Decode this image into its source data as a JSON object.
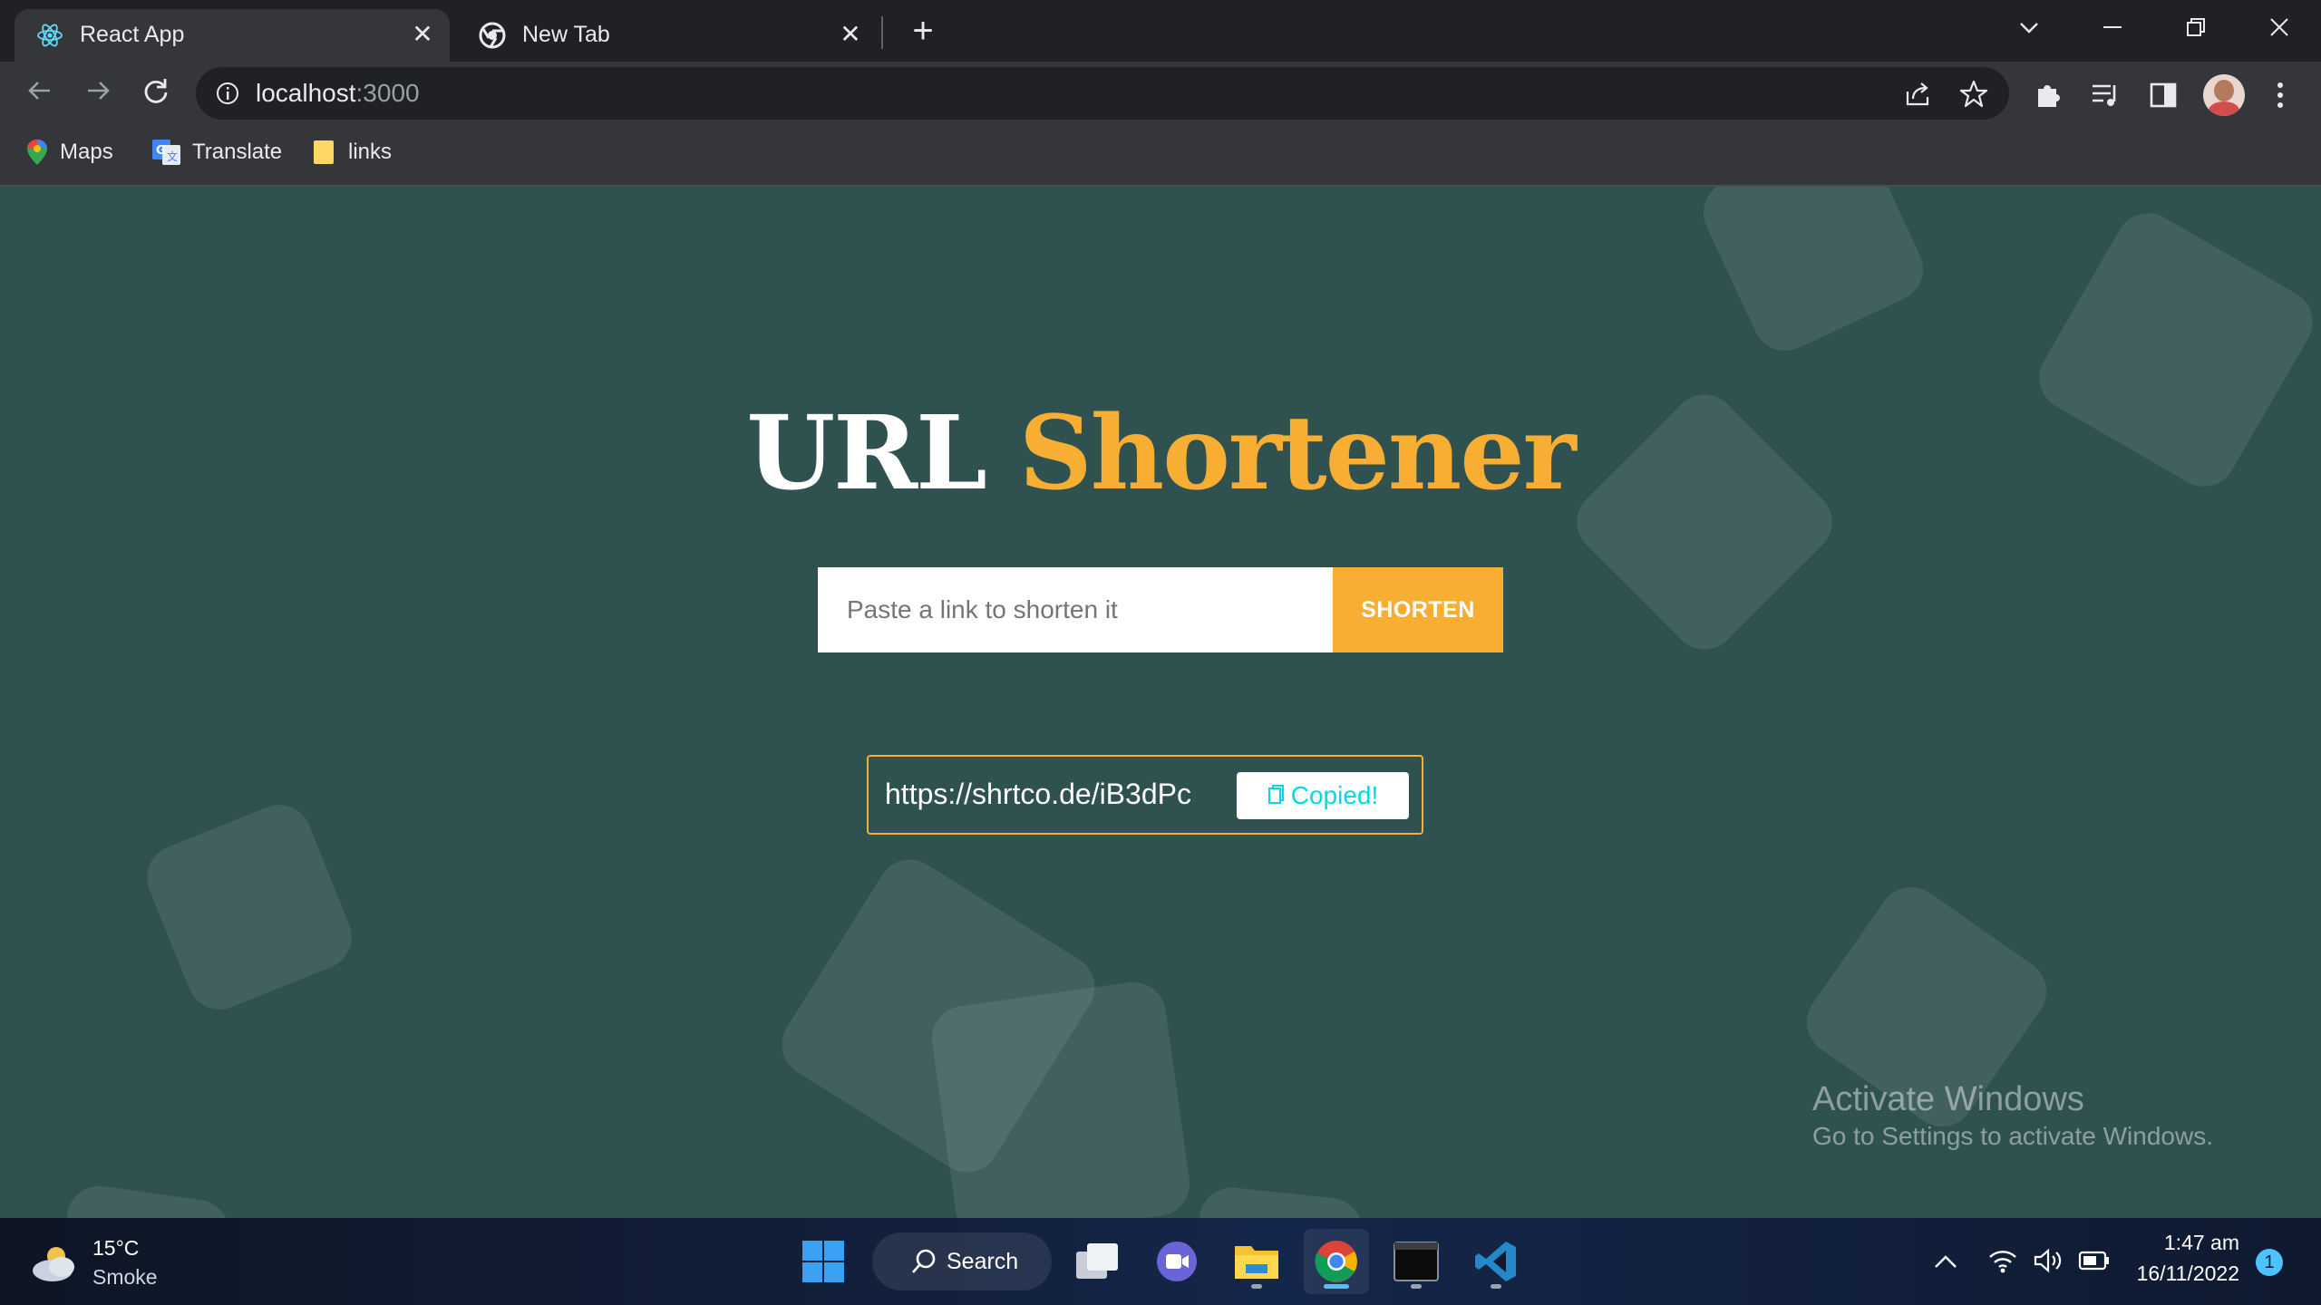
{
  "browser": {
    "tabs": [
      {
        "title": "React App",
        "icon": "react-icon",
        "active": true
      },
      {
        "title": "New Tab",
        "icon": "chrome-icon",
        "active": false
      }
    ],
    "address": {
      "host": "localhost",
      "port": ":3000"
    },
    "bookmarks": [
      {
        "label": "Maps",
        "icon": "maps-icon"
      },
      {
        "label": "Translate",
        "icon": "translate-icon"
      },
      {
        "label": "links",
        "icon": "folder-icon"
      }
    ]
  },
  "app": {
    "title_white": "URL",
    "title_orange": "Shortener",
    "input_placeholder": "Paste a link to shorten it",
    "shorten_label": "SHORTEN",
    "short_link": "https://shrtco.de/iB3dPc",
    "copied_label": "Copied!",
    "colors": {
      "background": "#2f514f",
      "accent": "#f7ae33",
      "copied_text": "#00d8e8"
    }
  },
  "watermark": {
    "line1": "Activate Windows",
    "line2": "Go to Settings to activate Windows."
  },
  "taskbar": {
    "weather": {
      "temp": "15°C",
      "condition": "Smoke"
    },
    "search_label": "Search",
    "time": "1:47 am",
    "date": "16/11/2022",
    "notification_count": "1"
  }
}
